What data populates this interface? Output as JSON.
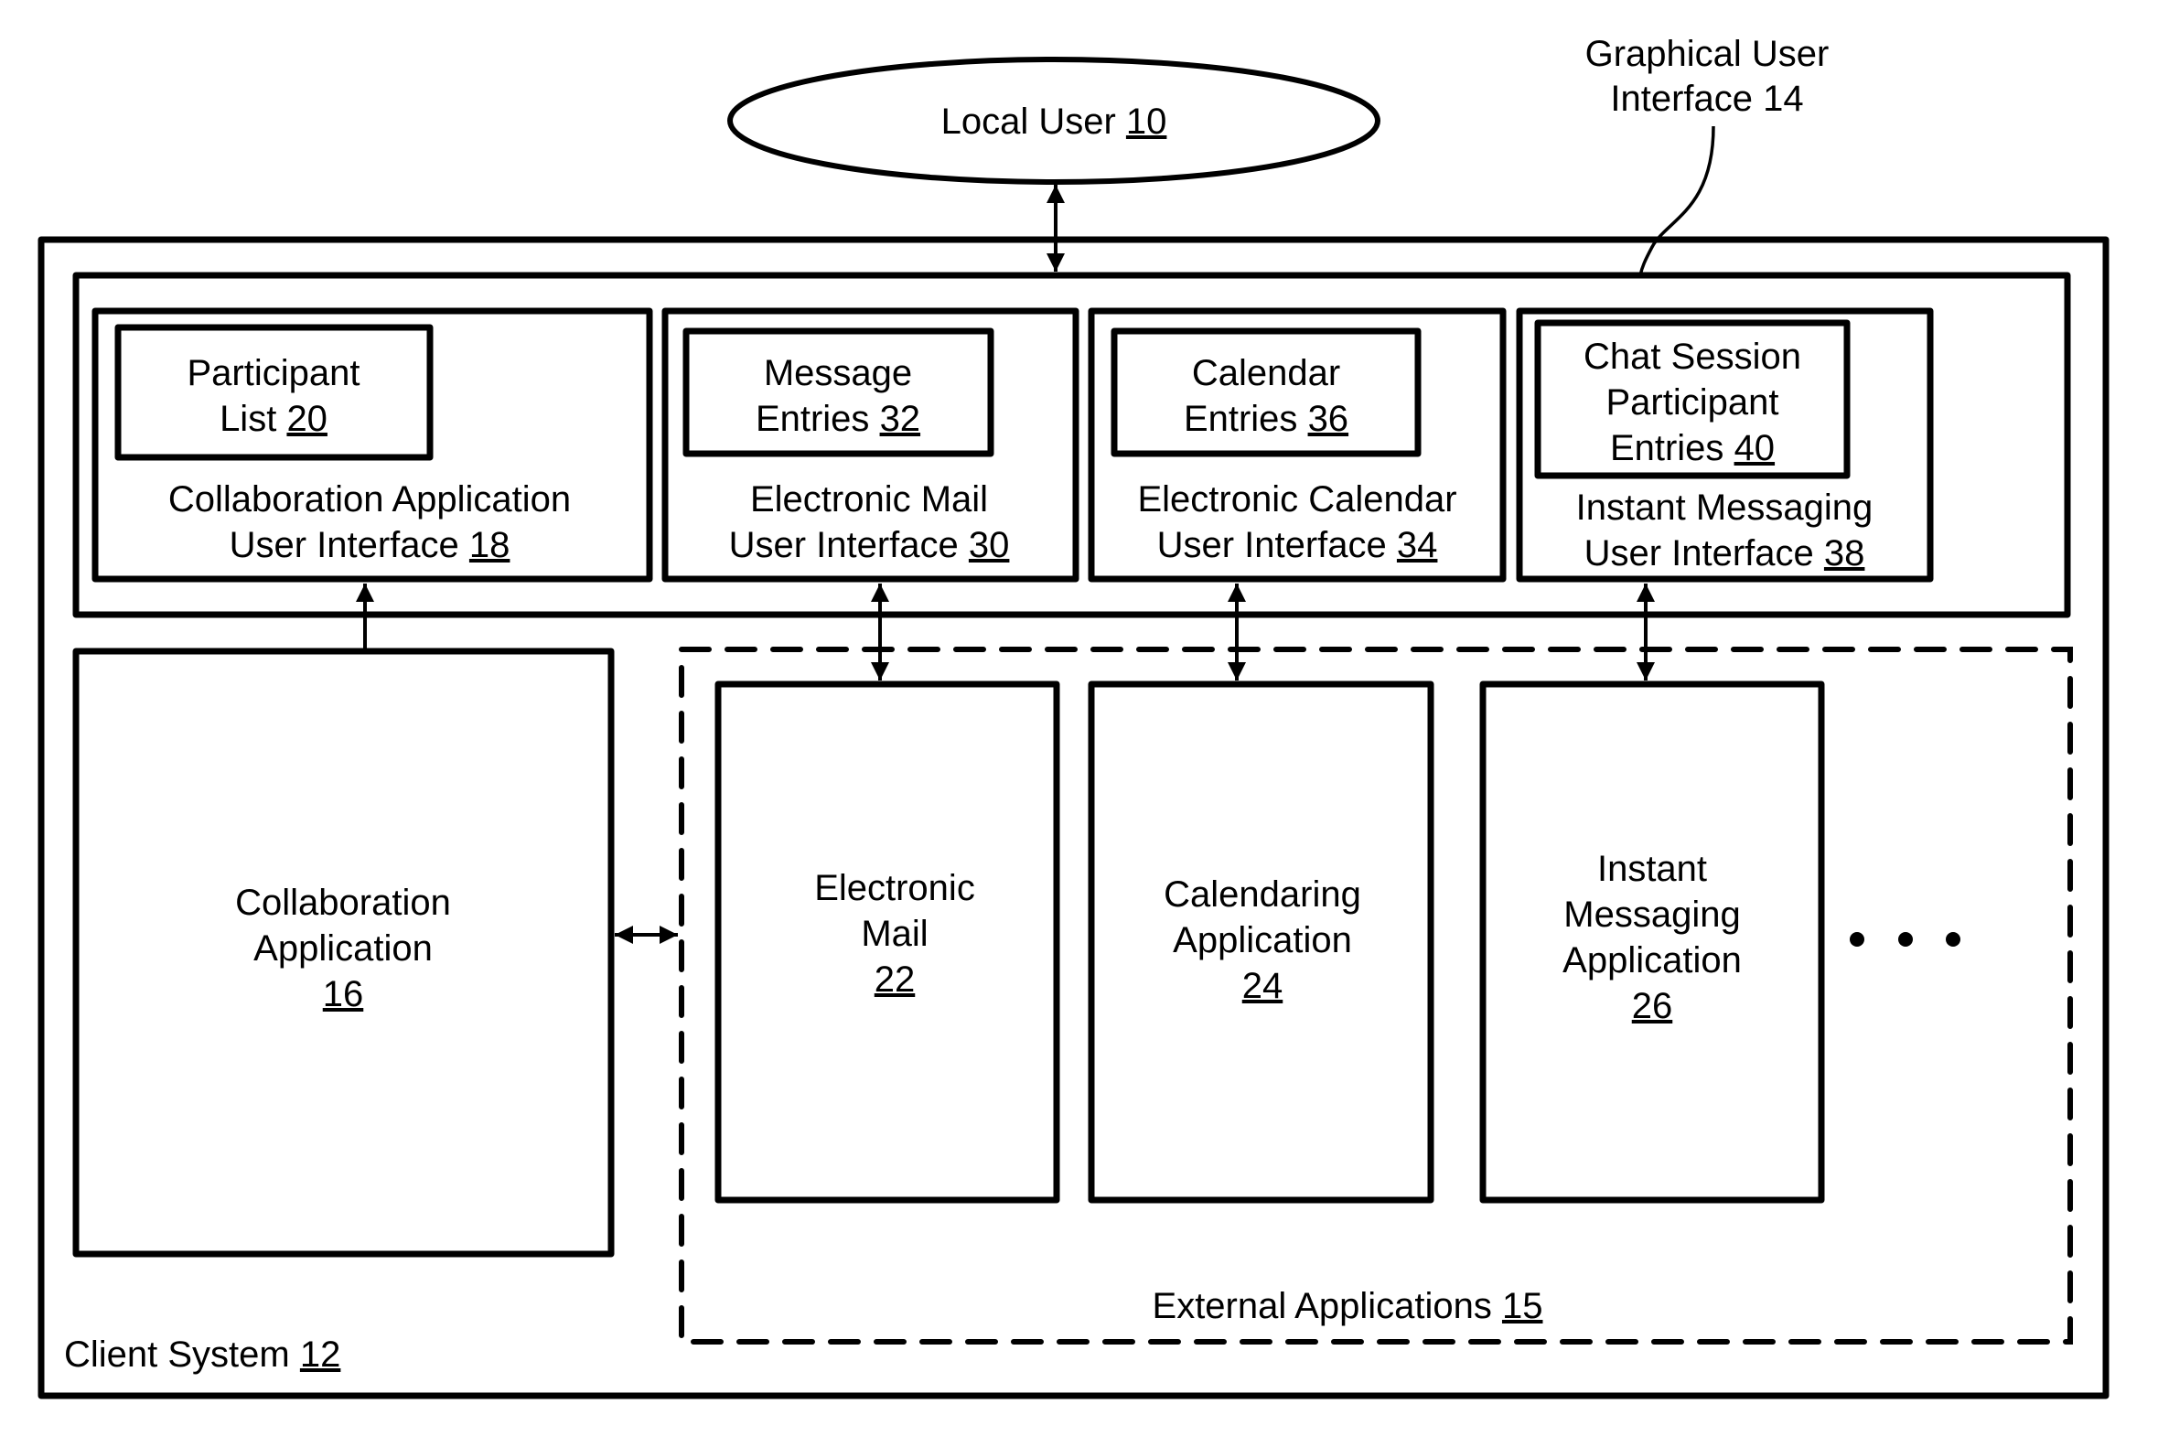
{
  "diagram": {
    "local_user": {
      "label": "Local User",
      "ref": "10"
    },
    "gui_label": {
      "line1": "Graphical User",
      "line2": "Interface 14"
    },
    "client_system": {
      "label": "Client System",
      "ref": "12"
    },
    "ui_panels": [
      {
        "inner_lines": [
          "Participant",
          "List"
        ],
        "inner_ref": "20",
        "title_lines": [
          "Collaboration Application",
          "User Interface"
        ],
        "title_ref": "18"
      },
      {
        "inner_lines": [
          "Message",
          "Entries"
        ],
        "inner_ref": "32",
        "title_lines": [
          "Electronic Mail",
          "User Interface"
        ],
        "title_ref": "30"
      },
      {
        "inner_lines": [
          "Calendar",
          "Entries"
        ],
        "inner_ref": "36",
        "title_lines": [
          "Electronic Calendar",
          "User Interface"
        ],
        "title_ref": "34"
      },
      {
        "inner_lines": [
          "Chat Session",
          "Participant",
          "Entries"
        ],
        "inner_ref": "40",
        "title_lines": [
          "Instant Messaging",
          "User Interface"
        ],
        "title_ref": "38"
      }
    ],
    "collaboration_app": {
      "lines": [
        "Collaboration",
        "Application"
      ],
      "ref": "16"
    },
    "external_apps": {
      "label": "External Applications",
      "ref": "15",
      "apps": [
        {
          "lines": [
            "Electronic",
            "Mail"
          ],
          "ref": "22"
        },
        {
          "lines": [
            "Calendaring",
            "Application"
          ],
          "ref": "24"
        },
        {
          "lines": [
            "Instant",
            "Messaging",
            "Application"
          ],
          "ref": "26"
        }
      ],
      "ellipsis": "more-apps"
    }
  }
}
